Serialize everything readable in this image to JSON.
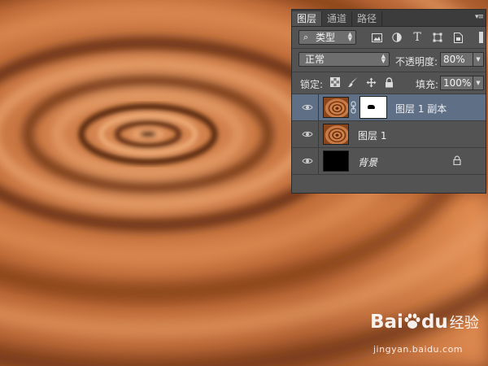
{
  "panel": {
    "tabs": [
      {
        "label": "图层",
        "active": true
      },
      {
        "label": "通道",
        "active": false
      },
      {
        "label": "路径",
        "active": false
      }
    ],
    "filter": {
      "label": "类型",
      "icons": [
        "image-filter-icon",
        "adjustment-filter-icon",
        "type-filter-icon",
        "shape-filter-icon",
        "smart-object-filter-icon"
      ]
    },
    "blend_mode": "正常",
    "opacity_label": "不透明度:",
    "opacity_value": "80%",
    "lock_label": "锁定:",
    "lock_icons": [
      "lock-transparent-pixels-icon",
      "lock-image-pixels-icon",
      "lock-position-icon",
      "lock-all-icon"
    ],
    "fill_label": "填充:",
    "fill_value": "100%",
    "layers": [
      {
        "name": "图层 1 副本",
        "selected": true,
        "visible": true,
        "has_mask": true
      },
      {
        "name": "图层 1",
        "selected": false,
        "visible": true,
        "has_mask": false
      },
      {
        "name": "背景",
        "selected": false,
        "visible": true,
        "locked": true
      }
    ]
  },
  "watermark": {
    "brand": "Bai",
    "brand_tail": "du",
    "brand_cn": "经验",
    "url": "jingyan.baidu.com"
  },
  "colors": {
    "panel_bg": "#535353",
    "selected_layer": "#5f6f86",
    "canvas_tone": "#c8733f"
  }
}
